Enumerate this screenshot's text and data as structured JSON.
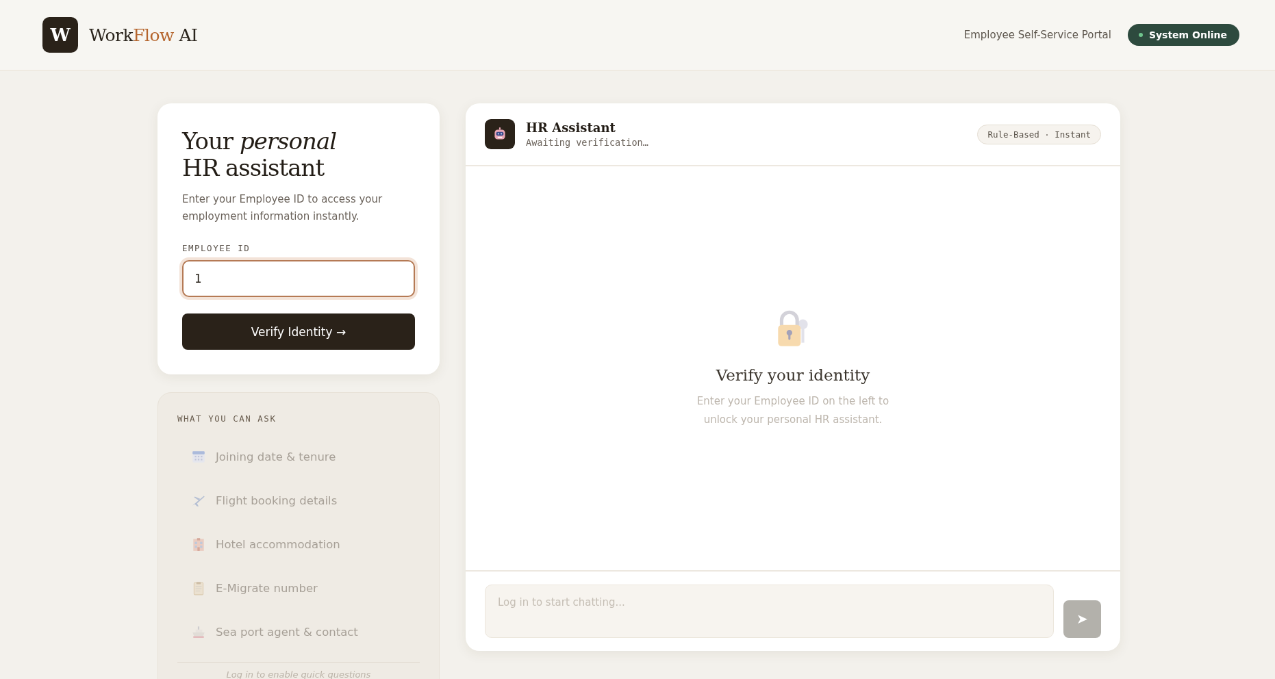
{
  "header": {
    "logo_mark": "W",
    "brand": [
      {
        "text": "Work",
        "accent": false
      },
      {
        "text": "Flow",
        "accent": true
      },
      {
        "text": " AI",
        "accent": false
      }
    ],
    "portal_label": "Employee Self-Service Portal",
    "status": {
      "label": "System Online",
      "online": true
    }
  },
  "login_card": {
    "heading_line_1": "Your *personal*",
    "heading_line_2": "HR assistant",
    "description": "Enter your Employee ID to access your employment information instantly.",
    "field_label": "EMPLOYEE ID",
    "field_value": "1",
    "field_focused": true,
    "button": "Verify Identity →"
  },
  "questions_card": {
    "title": "WHAT YOU CAN ASK",
    "items": [
      {
        "kind": "calendar",
        "label": "Joining date & tenure",
        "disabled": true
      },
      {
        "kind": "plane",
        "label": "Flight booking details",
        "disabled": true
      },
      {
        "kind": "hotel",
        "label": "Hotel accommodation",
        "disabled": true
      },
      {
        "kind": "clipboard",
        "label": "E-Migrate number",
        "disabled": true
      },
      {
        "kind": "ship",
        "label": "Sea port agent & contact",
        "disabled": true
      }
    ],
    "footer_note": "Log in to enable quick questions"
  },
  "chat": {
    "title": "HR Assistant",
    "subtitle": "Awaiting verification…",
    "mode_badge": "Rule-Based · Instant",
    "empty_title": "Verify your identity",
    "empty_text": "Enter your Employee ID on the left to unlock your personal HR assistant.",
    "input_placeholder": "Log in to start chatting...",
    "input_disabled": true,
    "send_button": "➤",
    "send_disabled": true
  }
}
